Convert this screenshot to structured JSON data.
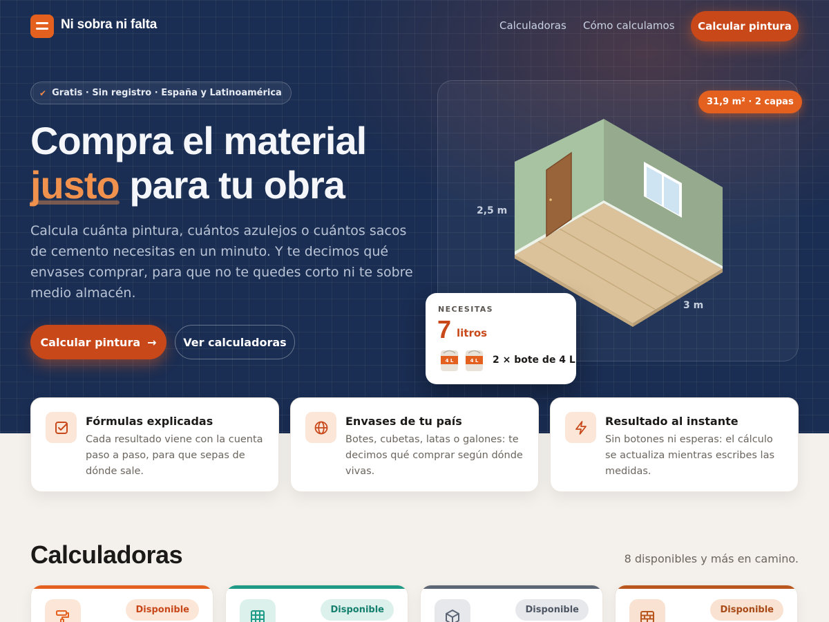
{
  "header": {
    "brand": "Ni sobra ni falta",
    "nav": [
      "Calculadoras",
      "Cómo calculamos"
    ],
    "cta": "Calcular pintura"
  },
  "hero": {
    "pill": "Gratis · Sin registro · España y Latinoamérica",
    "headline_line1": "Compra el material",
    "headline_accent": "justo",
    "headline_line2_rest": "para tu obra",
    "lead": "Calcula cuánta pintura, cuántos azulejos o cuántos sacos de cemento necesitas en un minuto. Y te decimos qué envases comprar, para que no te quedes corto ni te sobre medio almacén.",
    "primary_button": "Calcular pintura",
    "secondary_button": "Ver calculadoras"
  },
  "illustration": {
    "area_badge": "31,9 m² · 2 capas",
    "height_label": "2,5 m",
    "width_label": "3 m",
    "result": {
      "eyebrow": "NECESITAS",
      "value": "7",
      "unit": "litros",
      "can_label": "4 L",
      "cans_text": "2 × bote de 4 L"
    }
  },
  "features": [
    {
      "title": "Fórmulas explicadas",
      "desc": "Cada resultado viene con la cuenta paso a paso, para que sepas de dónde sale.",
      "icon": "checkbox-icon"
    },
    {
      "title": "Envases de tu país",
      "desc": "Botes, cubetas, latas o galones: te decimos qué comprar según dónde vivas.",
      "icon": "globe-icon"
    },
    {
      "title": "Resultado al instante",
      "desc": "Sin botones ni esperas: el cálculo se actualiza mientras escribes las medidas.",
      "icon": "lightning-icon"
    }
  ],
  "calculators": {
    "title": "Calculadoras",
    "count": "8 disponibles y más en camino.",
    "cards": [
      {
        "tag": "Disponible",
        "icon": "paint-roller-icon",
        "accent": "#e4601e"
      },
      {
        "tag": "Disponible",
        "icon": "tile-grid-icon",
        "accent": "#1e9a86"
      },
      {
        "tag": "Disponible",
        "icon": "cube-icon",
        "accent": "#5d6675"
      },
      {
        "tag": "Disponible",
        "icon": "brick-wall-icon",
        "accent": "#b8561e"
      }
    ]
  },
  "colors": {
    "navy": "#1a2d52",
    "orange": "#e4601e",
    "orange_dark": "#c8481a",
    "accent_text": "#f0914d",
    "cream": "#f4f1ec"
  }
}
